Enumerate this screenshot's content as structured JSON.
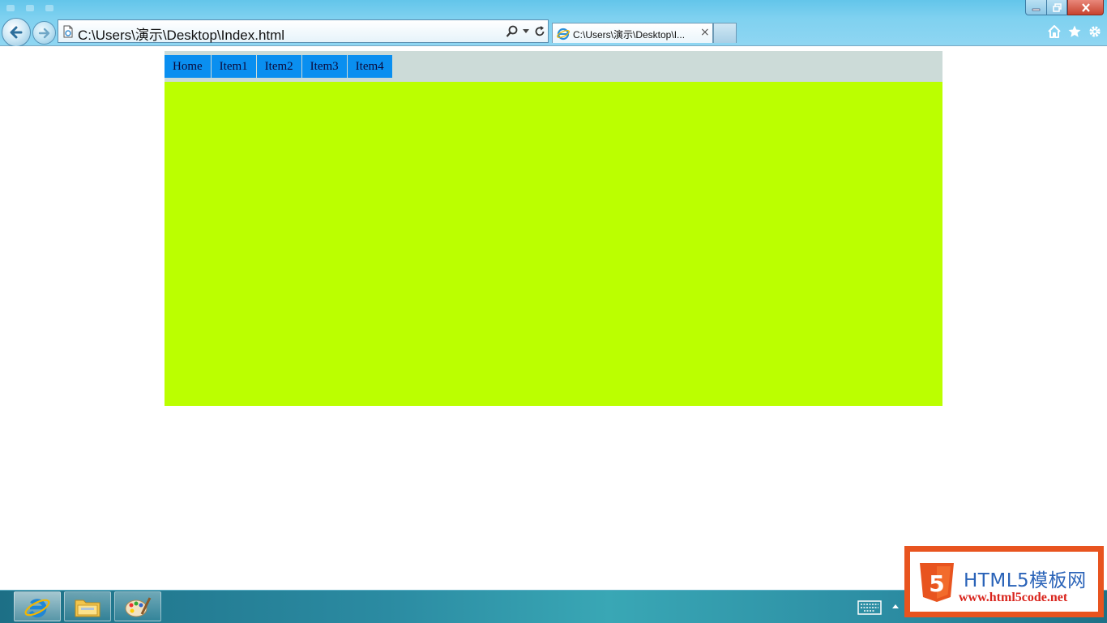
{
  "browser": {
    "address_url": "C:\\Users\\演示\\Desktop\\Index.html",
    "tab_label": "C:\\Users\\演示\\Desktop\\I...",
    "tab_close": "×",
    "window_controls": [
      "minimize-icon",
      "restore-icon",
      "close-icon"
    ],
    "toolbar_icons": [
      "home-icon",
      "star-icon",
      "gear-icon"
    ]
  },
  "page": {
    "nav_items": [
      {
        "label": "Home"
      },
      {
        "label": "Item1"
      },
      {
        "label": "Item2"
      },
      {
        "label": "Item3"
      },
      {
        "label": "Item4"
      }
    ],
    "colors": {
      "nav_bar_bg": "#ccdbd8",
      "nav_item_bg": "#0a8ff0",
      "content_bg": "#bbff00"
    }
  },
  "taskbar": {
    "pinned": [
      "internet-explorer-icon",
      "file-explorer-icon",
      "paint-icon"
    ],
    "tray": [
      "keyboard-icon",
      "show-hidden-icons-arrow"
    ]
  },
  "watermark": {
    "shield_text": "5",
    "title": "HTML5模板网",
    "url": "www.html5code.net"
  }
}
